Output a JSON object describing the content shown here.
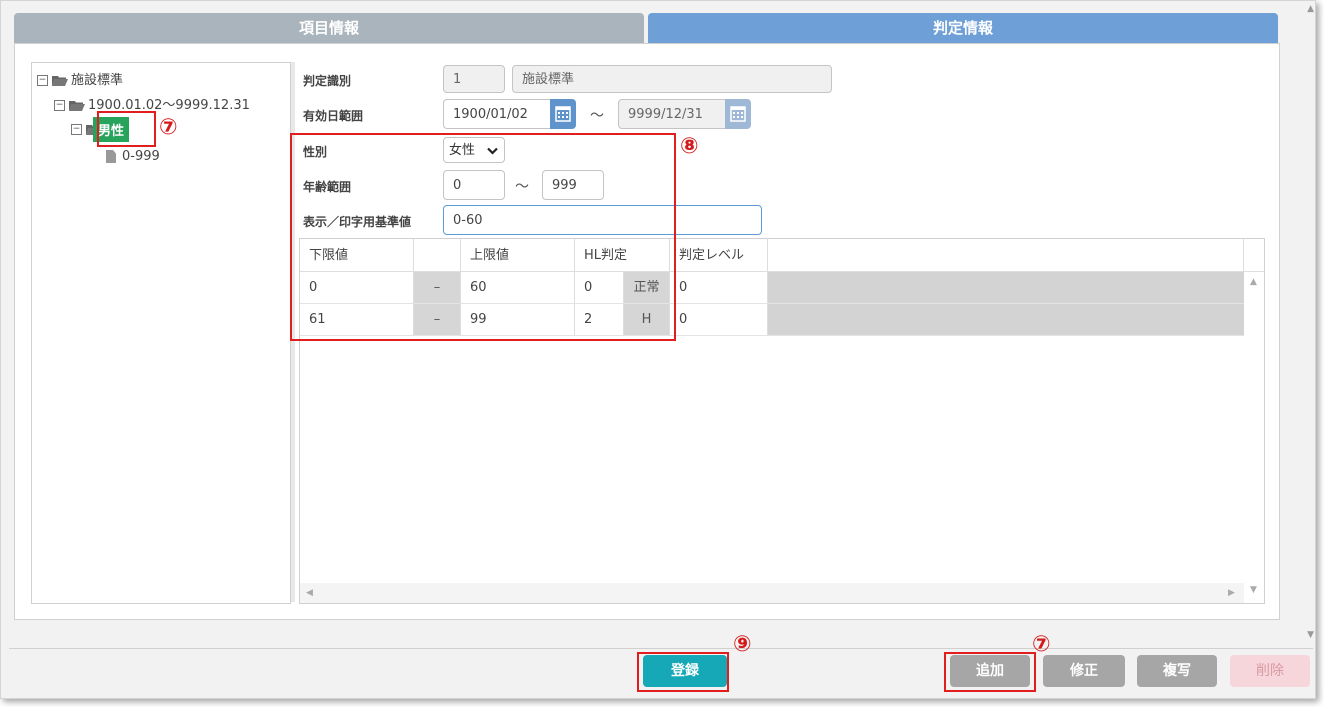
{
  "tabs": [
    {
      "label": "項目情報"
    },
    {
      "label": "判定情報"
    }
  ],
  "tree": {
    "root": "施設標準",
    "period": "1900.01.02～9999.12.31",
    "selected": "男性",
    "leaf": "0-999"
  },
  "form": {
    "judge_id_label": "判定識別",
    "judge_id_code": "1",
    "judge_id_name": "施設標準",
    "period_label": "有効日範囲",
    "period_from": "1900/01/02",
    "period_sep": "～",
    "period_to": "9999/12/31",
    "sex_label": "性別",
    "sex_value": "女性",
    "age_label": "年齢範囲",
    "age_from": "0",
    "age_sep": "～",
    "age_to": "999",
    "display_label": "表示／印字用基準値",
    "display_value": "0-60"
  },
  "grid": {
    "headers": [
      "下限値",
      "",
      "上限値",
      "HL判定",
      "判定レベル"
    ],
    "rows": [
      {
        "lower": "0",
        "dash": "–",
        "upper": "60",
        "hl_code": "0",
        "hl_text": "正常",
        "level": "0"
      },
      {
        "lower": "61",
        "dash": "–",
        "upper": "99",
        "hl_code": "2",
        "hl_text": "H",
        "level": "0"
      }
    ]
  },
  "annotations": {
    "n7a": "⑦",
    "n8": "⑧",
    "n9": "⑨",
    "n7b": "⑦"
  },
  "buttons": {
    "register": "登録",
    "add": "追加",
    "edit": "修正",
    "copy": "複写",
    "delete": "削除"
  },
  "colors": {
    "tab_inactive": "#a9b4bc",
    "tab_active": "#6e9fd6",
    "selected_node": "#27a35c",
    "register_button": "#16a8b6",
    "gray_button": "#a6a6a6",
    "delete_button": "#f6d6da",
    "annotation_red": "#e11d1d"
  }
}
